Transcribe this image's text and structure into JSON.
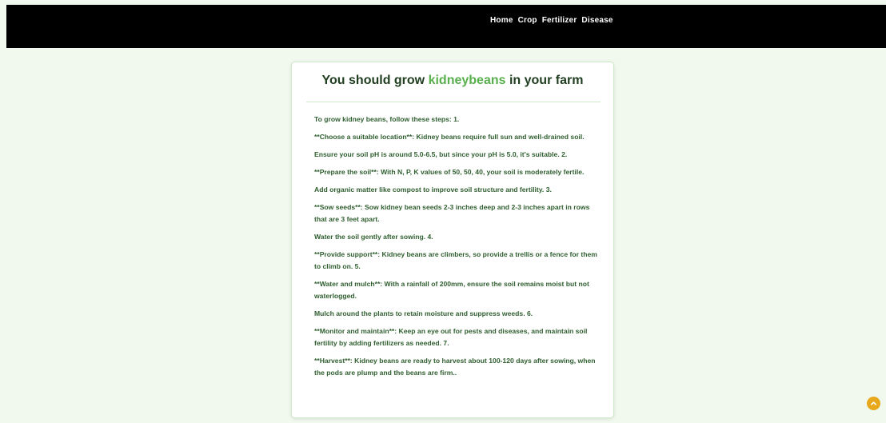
{
  "nav": {
    "items": [
      {
        "label": "Home"
      },
      {
        "label": "Crop"
      },
      {
        "label": "Fertilizer"
      },
      {
        "label": "Disease"
      }
    ]
  },
  "result": {
    "title_prefix": "You should grow",
    "crop": "kidneybeans",
    "title_suffix": "in your farm",
    "steps": [
      "To grow kidney beans, follow these steps: 1.",
      "**Choose a suitable location**: Kidney beans require full sun and well-drained soil.",
      "Ensure your soil pH is around 5.0-6.5, but since your pH is 5.0, it's suitable. 2.",
      "**Prepare the soil**: With N, P, K values of 50, 50, 40, your soil is moderately fertile.",
      "Add organic matter like compost to improve soil structure and fertility. 3.",
      "**Sow seeds**: Sow kidney bean seeds 2-3 inches deep and 2-3 inches apart in rows that are 3 feet apart.",
      "Water the soil gently after sowing. 4.",
      "**Provide support**: Kidney beans are climbers, so provide a trellis or a fence for them to climb on. 5.",
      "**Water and mulch**: With a rainfall of 200mm, ensure the soil remains moist but not waterlogged.",
      "Mulch around the plants to retain moisture and suppress weeds. 6.",
      "**Monitor and maintain**: Keep an eye out for pests and diseases, and maintain soil fertility by adding fertilizers as needed. 7.",
      "**Harvest**: Kidney beans are ready to harvest about 100-120 days after sowing, when the pods are plump and the beans are firm.."
    ]
  },
  "scroll_top": {
    "icon": "chevron-up-icon"
  },
  "colors": {
    "accent": "#58b04d",
    "text": "#2f5e2f",
    "background": "#f1f9ee",
    "scroll_button": "#e8a81c"
  }
}
